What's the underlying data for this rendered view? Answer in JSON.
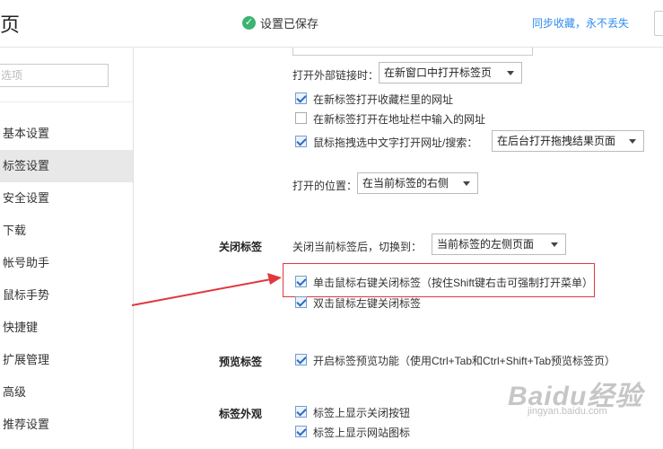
{
  "header": {
    "title": "页",
    "saved_status": "设置已保存",
    "sync_link": "同步收藏，永不丢失"
  },
  "sidebar": {
    "search_placeholder": "选项",
    "items": [
      {
        "label": "基本设置"
      },
      {
        "label": "标签设置"
      },
      {
        "label": "安全设置"
      },
      {
        "label": "下载"
      },
      {
        "label": "帐号助手"
      },
      {
        "label": "鼠标手势"
      },
      {
        "label": "快捷键"
      },
      {
        "label": "扩展管理"
      },
      {
        "label": "高级"
      },
      {
        "label": "推荐设置"
      }
    ],
    "active_index": 1
  },
  "open_tabs": {
    "external_link_label": "打开外部链接时：",
    "external_link_value": "在新窗口中打开标签页",
    "opt_favorites": "在新标签打开收藏栏里的网址",
    "opt_favorites_checked": true,
    "opt_addressbar": "在新标签打开在地址栏中输入的网址",
    "opt_addressbar_checked": false,
    "opt_drag": "鼠标拖拽选中文字打开网址/搜索：",
    "opt_drag_checked": true,
    "drag_value": "在后台打开拖拽结果页面",
    "position_label": "打开的位置：",
    "position_value": "在当前标签的右侧"
  },
  "close_tabs": {
    "section": "关闭标签",
    "after_close_label": "关闭当前标签后，切换到：",
    "after_close_value": "当前标签的左侧页面",
    "opt_right_click": "单击鼠标右键关闭标签（按住Shift键右击可强制打开菜单）",
    "opt_right_click_checked": true,
    "opt_double_click": "双击鼠标左键关闭标签",
    "opt_double_click_checked": true
  },
  "preview_tabs": {
    "section": "预览标签",
    "opt_preview": "开启标签预览功能（使用Ctrl+Tab和Ctrl+Shift+Tab预览标签页）",
    "opt_preview_checked": true
  },
  "tab_appearance": {
    "section": "标签外观",
    "opt_close_button": "标签上显示关闭按钮",
    "opt_close_button_checked": true,
    "opt_site_icon": "标签上显示网站图标",
    "opt_site_icon_checked": true
  },
  "annotation": {
    "color": "#e0383e"
  },
  "watermark": {
    "main": "Baidu经验",
    "sub": "jingyan.baidu.com"
  }
}
